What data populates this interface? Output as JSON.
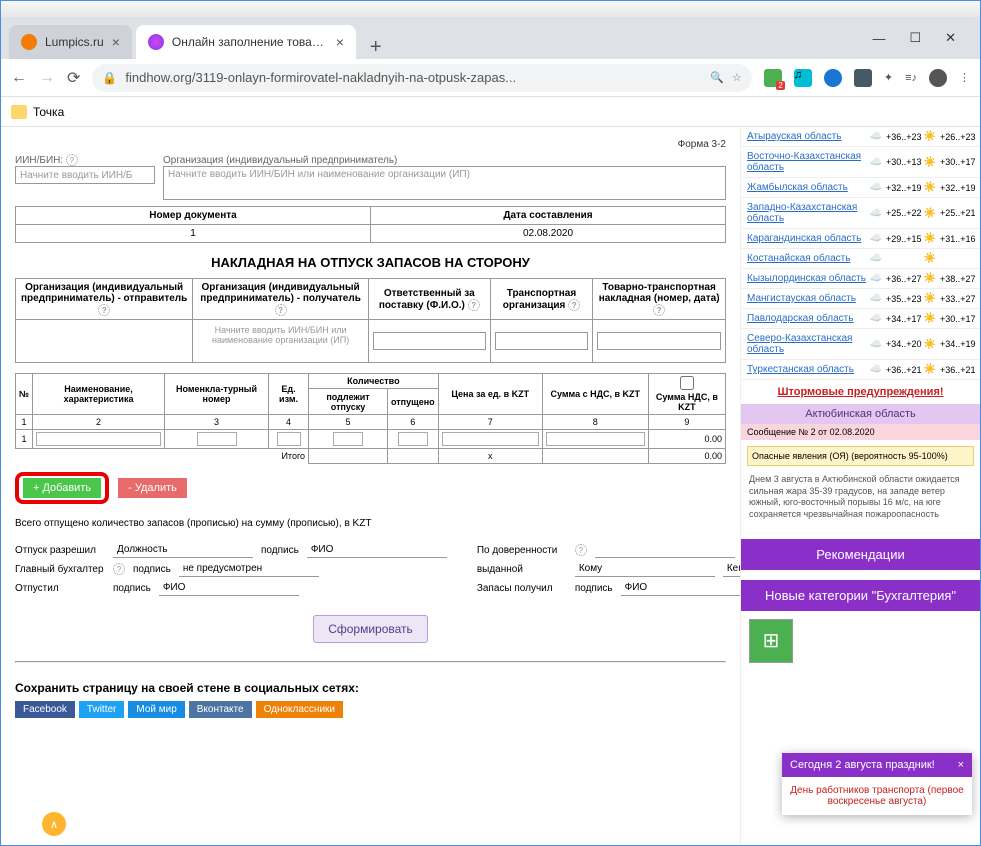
{
  "tabs": [
    {
      "title": "Lumpics.ru",
      "favicon": "#f57c00",
      "active": false
    },
    {
      "title": "Онлайн заполнение товарной н",
      "favicon": "#8e24aa",
      "active": true
    }
  ],
  "address_bar": {
    "url": "findhow.org/3119-onlayn-formirovatel-nakladnyih-na-otpusk-zapas..."
  },
  "bookmarks": [
    {
      "label": "Точка"
    }
  ],
  "form": {
    "form_no": "Форма 3-2",
    "iin_label": "ИИН/БИН:",
    "iin_placeholder": "Начните вводить ИИН/Б",
    "org_label": "Организация (индивидуальный предприниматель)",
    "org_placeholder": "Начните вводить ИИН/БИН или наименование организации (ИП)",
    "doc_no_header": "Номер документа",
    "doc_no_value": "1",
    "doc_date_header": "Дата составления",
    "doc_date_value": "02.08.2020",
    "title": "НАКЛАДНАЯ НА ОТПУСК ЗАПАСОВ НА СТОРОНУ",
    "headers": {
      "sender": "Организация (индивидуальный предприниматель) - отправитель",
      "receiver": "Организация (индивидуальный предприниматель) - получатель",
      "responsible": "Ответственный за поставку (Ф.И.О.)",
      "transport_org": "Транспортная организация",
      "ttn": "Товарно-транспортная накладная (номер, дата)"
    },
    "receiver_placeholder": "Начните вводить ИИН/БИН или наименование организации (ИП)",
    "items_headers": {
      "no": "№",
      "name": "Наименование, характеристика",
      "nomen": "Номенкла-турный номер",
      "unit": "Ед. изм.",
      "qty": "Количество",
      "qty_due": "подлежит отпуску",
      "qty_rel": "отпущено",
      "price": "Цена за ед. в KZT",
      "sum": "Сумма с НДС, в KZT",
      "vat": "Сумма НДС, в KZT"
    },
    "col_nums": [
      "1",
      "2",
      "3",
      "4",
      "5",
      "6",
      "7",
      "8",
      "9"
    ],
    "row_no": "1",
    "itogo": "Итого",
    "total_x": "x",
    "total_val": "0.00",
    "btn_add": "+ Добавить",
    "btn_del": "- Удалить",
    "total_text": "Всего отпущено количество запасов (прописью) на сумму (прописью), в KZT",
    "sign_labels": {
      "permit": "Отпуск разрешил",
      "position": "Должность",
      "signature": "подпись",
      "fio": "ФИО",
      "chief_acc": "Главный бухгалтер",
      "not_provided": "не предусмотрен",
      "released": "Отпустил",
      "by_proxy": "По доверенности",
      "issued": "выданной",
      "kom": "Кому",
      "kem": "Кем",
      "received": "Запасы получил"
    },
    "btn_form": "Сформировать",
    "social_label": "Сохранить страницу на своей стене в социальных сетях:",
    "social": [
      {
        "label": "Facebook",
        "color": "#3b5998"
      },
      {
        "label": "Twitter",
        "color": "#1da1f2"
      },
      {
        "label": "Мой мир",
        "color": "#168de2"
      },
      {
        "label": "Вконтакте",
        "color": "#4c75a3"
      },
      {
        "label": "Одноклассники",
        "color": "#ee8208"
      }
    ]
  },
  "sidebar": {
    "weather": [
      {
        "name": "Атырауская область",
        "t1": "+36..+23",
        "t2": "+26..+23"
      },
      {
        "name": "Восточно-Казахстанская область",
        "t1": "+30..+13",
        "t2": "+30..+17"
      },
      {
        "name": "Жамбылская область",
        "t1": "+32..+19",
        "t2": "+32..+19"
      },
      {
        "name": "Западно-Казахстанская область",
        "t1": "+25..+22",
        "t2": "+25..+21"
      },
      {
        "name": "Карагандинская область",
        "t1": "+29..+15",
        "t2": "+31..+16"
      },
      {
        "name": "Костанайская область",
        "t1": "",
        "t2": ""
      },
      {
        "name": "Кызылординская область",
        "t1": "+36..+27",
        "t2": "+38..+27"
      },
      {
        "name": "Мангистауская область",
        "t1": "+35..+23",
        "t2": "+33..+27"
      },
      {
        "name": "Павлодарская область",
        "t1": "+34..+17",
        "t2": "+30..+17"
      },
      {
        "name": "Северо-Казахстанская область",
        "t1": "+34..+20",
        "t2": "+34..+19"
      },
      {
        "name": "Туркестанская область",
        "t1": "+36..+21",
        "t2": "+36..+21"
      }
    ],
    "storm_warning": "Штормовые предупреждения!",
    "region_header": "Актюбинская область",
    "msg_header": "Сообщение № 2 от 02.08.2020",
    "msg_danger": "Опасные явления (ОЯ) (вероятность 95-100%)",
    "msg_body": "Днем 3 августа в Актюбинской области ожидается сильная жара 35-39 градусов, на западе ветер южный, юго-восточный порывы 16 м/с, на юге сохраняется чрезвычайная пожароопасность",
    "recommendations": "Рекомендации",
    "new_cat": "Новые категории \"Бухгалтерия\"",
    "notif_header": "Сегодня 2 августа праздник!",
    "notif_body": "День работников транспорта (первое воскресенье августа)"
  }
}
